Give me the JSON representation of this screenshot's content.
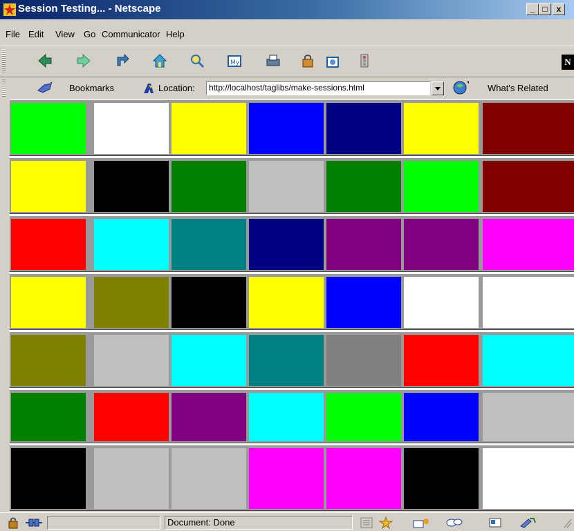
{
  "window": {
    "title": "Session Testing... - Netscape",
    "controls": [
      "_",
      "□",
      "x"
    ]
  },
  "menu": {
    "items": [
      "File",
      "Edit",
      "View",
      "Go",
      "Communicator",
      "Help"
    ]
  },
  "nav_toolbar": {
    "buttons": [
      "back-icon",
      "forward-icon",
      "reload-icon",
      "home-icon",
      "search-icon",
      "my-netscape-icon",
      "print-icon",
      "security-icon",
      "shop-icon",
      "stop-icon"
    ],
    "brand_logo": "N"
  },
  "location_bar": {
    "bookmarks_label": "Bookmarks",
    "location_label": "Location:",
    "url": "http://localhost/taglibs/make-sessions.html",
    "whats_related_label": "What's Related"
  },
  "grid": {
    "rows": [
      [
        "#00ff00",
        "#ffffff",
        "#ffff00",
        "#0000ff",
        "#000080",
        "#ffff00",
        "#800000"
      ],
      [
        "#ffff00",
        "#000000",
        "#008000",
        "#c0c0c0",
        "#008000",
        "#00ff00",
        "#800000"
      ],
      [
        "#ff0000",
        "#00ffff",
        "#008080",
        "#000080",
        "#800080",
        "#800080",
        "#ff00ff"
      ],
      [
        "#ffff00",
        "#808000",
        "#000000",
        "#ffff00",
        "#0000ff",
        "#ffffff",
        "#ffffff"
      ],
      [
        "#808000",
        "#c0c0c0",
        "#00ffff",
        "#008080",
        "#808080",
        "#ff0000",
        "#00ffff"
      ],
      [
        "#008000",
        "#ff0000",
        "#800080",
        "#00ffff",
        "#00ff00",
        "#0000ff",
        "#c0c0c0"
      ],
      [
        "#000000",
        "#c0c0c0",
        "#c0c0c0",
        "#ff00ff",
        "#ff00ff",
        "#000000",
        "#ffffff"
      ]
    ]
  },
  "status_bar": {
    "status_text": "Document: Done"
  }
}
